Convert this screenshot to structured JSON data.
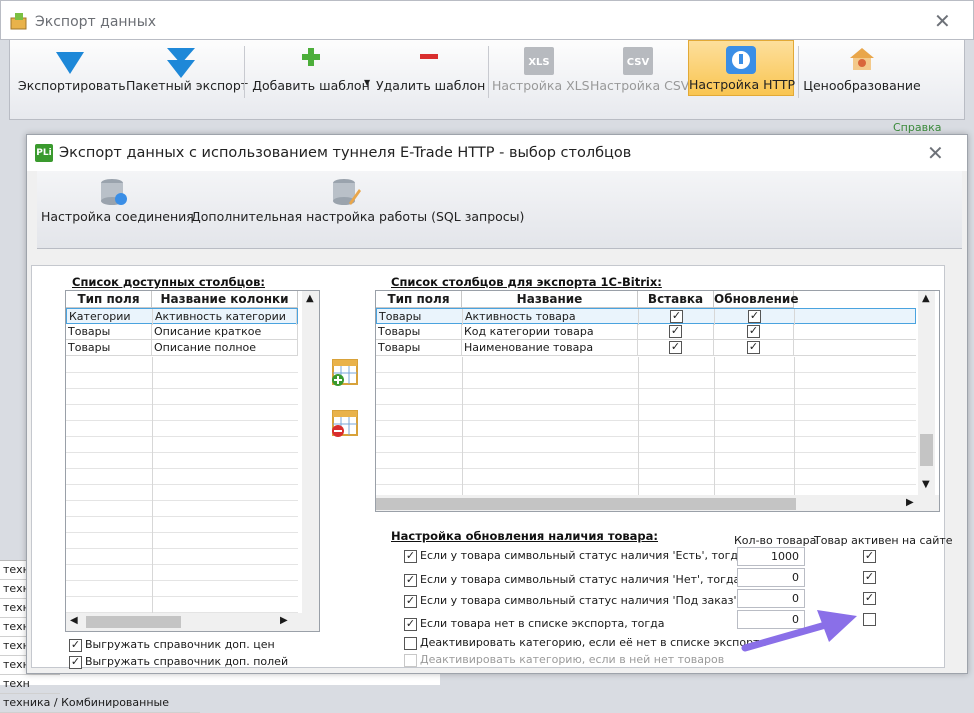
{
  "window": {
    "title": "Экспорт данных"
  },
  "toolbar": {
    "export": "Экспортировать",
    "batch_export": "Пакетный экспорт",
    "add_template": "Добавить шаблон",
    "remove_template": "Удалить шаблон",
    "xls_settings": "Настройка XLS",
    "csv_settings": "Настройка CSV",
    "http_settings": "Настройка HTTP",
    "pricing": "Ценообразование",
    "xls_icon_text": "XLS",
    "csv_icon_text": "CSV"
  },
  "help_link": "Справка",
  "background_rows": [
    "техн",
    "техн",
    "техн",
    "техн",
    "техн",
    "техн",
    "техн"
  ],
  "background_last": "техника / Комбинированные",
  "dialog": {
    "logo_text": "PLi",
    "title": "Экспорт данных с использованием туннеля E-Trade HTTP - выбор столбцов",
    "toolbar": {
      "connection": "Настройка соединения",
      "advanced": "Дополнительная настройка работы (SQL запросы)"
    },
    "available": {
      "label": "Список доступных столбцов:",
      "headers": [
        "Тип поля",
        "Название колонки"
      ],
      "rows": [
        [
          "Категории",
          "Активность категории"
        ],
        [
          "Товары",
          "Описание краткое"
        ],
        [
          "Товары",
          "Описание полное"
        ]
      ]
    },
    "export_cols": {
      "label": "Список столбцов для экспорта 1C-Bitrix:",
      "headers": [
        "Тип поля",
        "Название",
        "Вставка",
        "Обновление"
      ],
      "rows": [
        {
          "type": "Товары",
          "name": "Активность товара",
          "insert": true,
          "update": true
        },
        {
          "type": "Товары",
          "name": "Код категории товара",
          "insert": true,
          "update": true
        },
        {
          "type": "Товары",
          "name": "Наименование товара",
          "insert": true,
          "update": true
        }
      ]
    },
    "checkboxes_left": [
      {
        "label": "Выгружать справочник доп. цен",
        "checked": true
      },
      {
        "label": "Выгружать справочник доп. полей",
        "checked": true
      }
    ],
    "stock": {
      "label": "Настройка обновления наличия товара:",
      "col_qty": "Кол-во товара",
      "col_active": "Товар активен на сайте",
      "rows": [
        {
          "label": "Если у товара символьный статус наличия 'Есть', тогда",
          "checked": true,
          "qty": "1000",
          "active": true
        },
        {
          "label": "Если у товара символьный статус наличия 'Нет', тогда",
          "checked": true,
          "qty": "0",
          "active": true
        },
        {
          "label": "Если у товара символьный статус наличия 'Под заказ', тогда",
          "checked": true,
          "qty": "0",
          "active": true
        },
        {
          "label": "Если товара нет в списке экспорта, тогда",
          "checked": true,
          "qty": "0",
          "active": false
        }
      ],
      "deactivate_missing": "Деактивировать категорию, если её нет в списке экспорта",
      "deactivate_empty": "Деактивировать категорию, если в ней нет товаров"
    }
  },
  "colors": {
    "accent_arrow": "#8a6fe8",
    "active_button": "#f9c551",
    "selection": "#4aa3df"
  }
}
